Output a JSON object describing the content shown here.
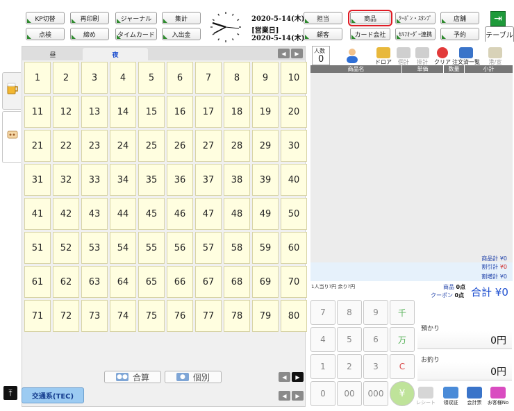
{
  "toolbar": {
    "row1": [
      "KP切替",
      "再印刷",
      "ジャーナル",
      "集計"
    ],
    "row2": [
      "点検",
      "締め",
      "タイムカード",
      "入出金"
    ],
    "right_row1": [
      "担当",
      "商品",
      "ｸｰﾎﾟﾝ・ｽﾀﾝﾌﾟ",
      "店舗"
    ],
    "right_row2": [
      "顧客",
      "カード会社",
      "ｾﾙﾌｵｰﾀﾞｰ連携",
      "予約"
    ],
    "selected": "商品"
  },
  "header": {
    "date": "2020-5-14(木)",
    "business_day_label": "[営業日]",
    "business_date": "2020-5-14(木)",
    "table_tab": "テーブル"
  },
  "tabs": {
    "day": "昼",
    "night": "夜"
  },
  "tables": [
    "1",
    "2",
    "3",
    "4",
    "5",
    "6",
    "7",
    "8",
    "9",
    "10",
    "11",
    "12",
    "13",
    "14",
    "15",
    "16",
    "17",
    "18",
    "19",
    "20",
    "21",
    "22",
    "23",
    "24",
    "25",
    "26",
    "27",
    "28",
    "29",
    "30",
    "31",
    "32",
    "33",
    "34",
    "35",
    "36",
    "37",
    "38",
    "39",
    "40",
    "41",
    "42",
    "43",
    "44",
    "45",
    "46",
    "47",
    "48",
    "49",
    "50",
    "51",
    "52",
    "53",
    "54",
    "55",
    "56",
    "57",
    "58",
    "59",
    "60",
    "61",
    "62",
    "63",
    "64",
    "65",
    "66",
    "67",
    "68",
    "69",
    "70",
    "71",
    "72",
    "73",
    "74",
    "75",
    "76",
    "77",
    "78",
    "79",
    "80"
  ],
  "bottom": {
    "combined": "合算",
    "individual": "個別",
    "payment_method": "交通系(TEC)"
  },
  "order": {
    "people_label": "人数",
    "people_value": "0",
    "tools": [
      "ドロア",
      "個計",
      "掛計",
      "クリア",
      "注文済一覧",
      "港/宣"
    ],
    "columns": [
      "商品名",
      "単価",
      "数量",
      "小計"
    ],
    "subtotal_label": "商品計",
    "subtotal_value": "¥0",
    "discount_label": "割引計",
    "discount_value": "¥0",
    "surcharge_label": "割増計",
    "surcharge_value": "¥0",
    "per_person": "1人当り?円 余り?円",
    "item_count_label": "商品",
    "item_count": "0点",
    "coupon_label": "クーポン",
    "coupon_count": "0点",
    "total_label": "合計",
    "total_value": "¥0"
  },
  "keypad": [
    "7",
    "8",
    "9",
    "千",
    "4",
    "5",
    "6",
    "万",
    "1",
    "2",
    "3",
    "C",
    "0",
    "00",
    "000",
    "¥"
  ],
  "money": {
    "received_label": "預かり",
    "received_value": "0円",
    "change_label": "お釣り",
    "change_value": "0円"
  },
  "receipts": [
    "レシート",
    "領収証",
    "会計票",
    "お客様No"
  ],
  "colors": {
    "table_cell": "#fffee0",
    "active_tab": "#1d4fd0",
    "selected_outline": "#e01b24",
    "total": "#1d4fd0",
    "discount": "#d0201b"
  }
}
